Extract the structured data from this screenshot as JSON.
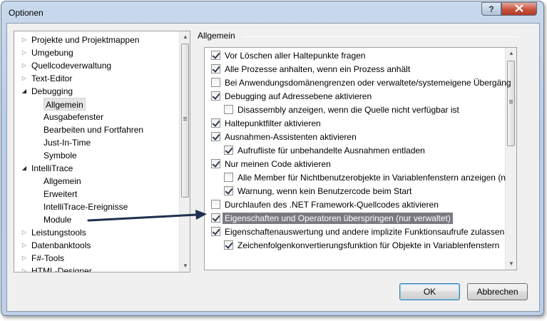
{
  "window": {
    "title": "Optionen",
    "help_label": "?",
    "close_label": "X"
  },
  "tree": {
    "items": [
      {
        "label": "Projekte und Projektmappen",
        "level": 0,
        "arrow": "closed"
      },
      {
        "label": "Umgebung",
        "level": 0,
        "arrow": "closed"
      },
      {
        "label": "Quellcodeverwaltung",
        "level": 0,
        "arrow": "closed"
      },
      {
        "label": "Text-Editor",
        "level": 0,
        "arrow": "closed"
      },
      {
        "label": "Debugging",
        "level": 0,
        "arrow": "open"
      },
      {
        "label": "Allgemein",
        "level": 1,
        "arrow": "none",
        "selected": true
      },
      {
        "label": "Ausgabefenster",
        "level": 1,
        "arrow": "none"
      },
      {
        "label": "Bearbeiten und Fortfahren",
        "level": 1,
        "arrow": "none"
      },
      {
        "label": "Just-In-Time",
        "level": 1,
        "arrow": "none"
      },
      {
        "label": "Symbole",
        "level": 1,
        "arrow": "none"
      },
      {
        "label": "IntelliTrace",
        "level": 0,
        "arrow": "open"
      },
      {
        "label": "Allgemein",
        "level": 1,
        "arrow": "none"
      },
      {
        "label": "Erweitert",
        "level": 1,
        "arrow": "none"
      },
      {
        "label": "IntelliTrace-Ereignisse",
        "level": 1,
        "arrow": "none"
      },
      {
        "label": "Module",
        "level": 1,
        "arrow": "none"
      },
      {
        "label": "Leistungstools",
        "level": 0,
        "arrow": "closed"
      },
      {
        "label": "Datenbanktools",
        "level": 0,
        "arrow": "closed"
      },
      {
        "label": "F#-Tools",
        "level": 0,
        "arrow": "closed"
      },
      {
        "label": "HTML-Designer",
        "level": 0,
        "arrow": "closed"
      }
    ]
  },
  "group": {
    "label": "Allgemein"
  },
  "options": [
    {
      "label": "Vor Löschen aller Haltepunkte fragen",
      "checked": true,
      "indent": 0
    },
    {
      "label": "Alle Prozesse anhalten, wenn ein Prozess anhält",
      "checked": true,
      "indent": 0
    },
    {
      "label": "Bei Anwendungsdomänengrenzen oder verwaltete/systemeigene Übergäng",
      "checked": false,
      "indent": 0
    },
    {
      "label": "Debugging auf Adressebene aktivieren",
      "checked": true,
      "indent": 0
    },
    {
      "label": "Disassembly anzeigen, wenn die Quelle nicht verfügbar ist",
      "checked": false,
      "indent": 1
    },
    {
      "label": "Haltepunktfilter aktivieren",
      "checked": true,
      "indent": 0
    },
    {
      "label": "Ausnahmen-Assistenten aktivieren",
      "checked": true,
      "indent": 0
    },
    {
      "label": "Aufrufliste für unbehandelte Ausnahmen entladen",
      "checked": true,
      "indent": 1
    },
    {
      "label": "Nur meinen Code aktivieren",
      "checked": true,
      "indent": 0
    },
    {
      "label": "Alle Member für Nichtbenutzerobjekte in Variablenfenstern anzeigen (n",
      "checked": false,
      "indent": 1
    },
    {
      "label": "Warnung, wenn kein Benutzercode beim Start",
      "checked": true,
      "indent": 1
    },
    {
      "label": "Durchlaufen des .NET Framework-Quellcodes aktivieren",
      "checked": false,
      "indent": 0
    },
    {
      "label": "Eigenschaften und Operatoren überspringen (nur verwaltet)",
      "checked": true,
      "indent": 0,
      "highlighted": true
    },
    {
      "label": "Eigenschaftenauswertung und andere implizite Funktionsaufrufe zulassen",
      "checked": true,
      "indent": 0
    },
    {
      "label": "Zeichenfolgenkonvertierungsfunktion für Objekte in Variablenfenstern",
      "checked": true,
      "indent": 1
    }
  ],
  "buttons": {
    "ok": "OK",
    "cancel": "Abbrechen"
  },
  "colors": {
    "annotation_arrow": "#1f2f4f",
    "highlight": "#7a7a82"
  }
}
